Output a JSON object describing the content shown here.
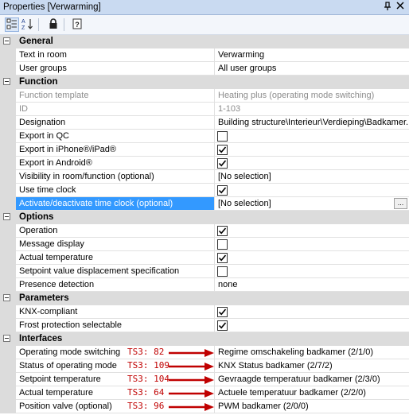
{
  "window": {
    "title": "Properties [Verwarming]",
    "pin_icon": "pin-icon",
    "close_icon": "close-icon"
  },
  "toolbar": {
    "buttons": [
      "categorized-icon",
      "sort-alpha-icon",
      "lock-icon",
      "help-icon"
    ]
  },
  "categories": {
    "general": "General",
    "function": "Function",
    "options": "Options",
    "parameters": "Parameters",
    "interfaces": "Interfaces"
  },
  "rows": {
    "text_in_room": {
      "name": "Text in room",
      "value": "Verwarming"
    },
    "user_groups": {
      "name": "User groups",
      "value": "All user groups"
    },
    "function_template": {
      "name": "Function template",
      "value": "Heating plus (operating mode switching)"
    },
    "id": {
      "name": "ID",
      "value": "1-103"
    },
    "designation": {
      "name": "Designation",
      "value": "Building structure\\Interieur\\Verdieping\\Badkamer..."
    },
    "export_qc": {
      "name": "Export in QC",
      "checked": false
    },
    "export_iphone": {
      "name": "Export in iPhone®/iPad®",
      "checked": true
    },
    "export_android": {
      "name": "Export in Android®",
      "checked": true
    },
    "visibility": {
      "name": "Visibility in room/function (optional)",
      "value": "[No selection]"
    },
    "use_time_clock": {
      "name": "Use time clock",
      "checked": true
    },
    "activate_time_clock": {
      "name": "Activate/deactivate time clock (optional)",
      "value": "[No selection]",
      "button": "..."
    },
    "operation": {
      "name": "Operation",
      "checked": true
    },
    "message_display": {
      "name": "Message display",
      "checked": false
    },
    "actual_temperature_opt": {
      "name": "Actual temperature",
      "checked": true
    },
    "setpoint_displacement": {
      "name": "Setpoint value displacement specification",
      "checked": false
    },
    "presence_detection": {
      "name": "Presence detection",
      "value": "none"
    },
    "knx_compliant": {
      "name": "KNX-compliant",
      "checked": true
    },
    "frost_protection": {
      "name": "Frost protection selectable",
      "checked": true
    },
    "operating_mode_switching": {
      "name": "Operating mode switching",
      "annotation": "TS3: 82",
      "value": "Regime omschakeling badkamer (2/1/0)"
    },
    "status_operating_mode": {
      "name": "Status of operating mode",
      "annotation": "TS3: 109",
      "value": "KNX Status badkamer (2/7/2)"
    },
    "setpoint_temperature": {
      "name": "Setpoint temperature",
      "annotation": "TS3: 104",
      "value": "Gevraagde temperatuur badkamer (2/3/0)"
    },
    "actual_temperature": {
      "name": "Actual temperature",
      "annotation": "TS3: 64",
      "value": "Actuele temperatuur badkamer (2/2/0)"
    },
    "position_valve": {
      "name": "Position valve (optional)",
      "annotation": "TS3: 96",
      "value": "PWM badkamer (2/0/0)"
    }
  },
  "colors": {
    "selection": "#3399ff",
    "annotation": "#c00000",
    "category_bg": "#dcdcdc",
    "titlebar": "#c9daf1"
  }
}
